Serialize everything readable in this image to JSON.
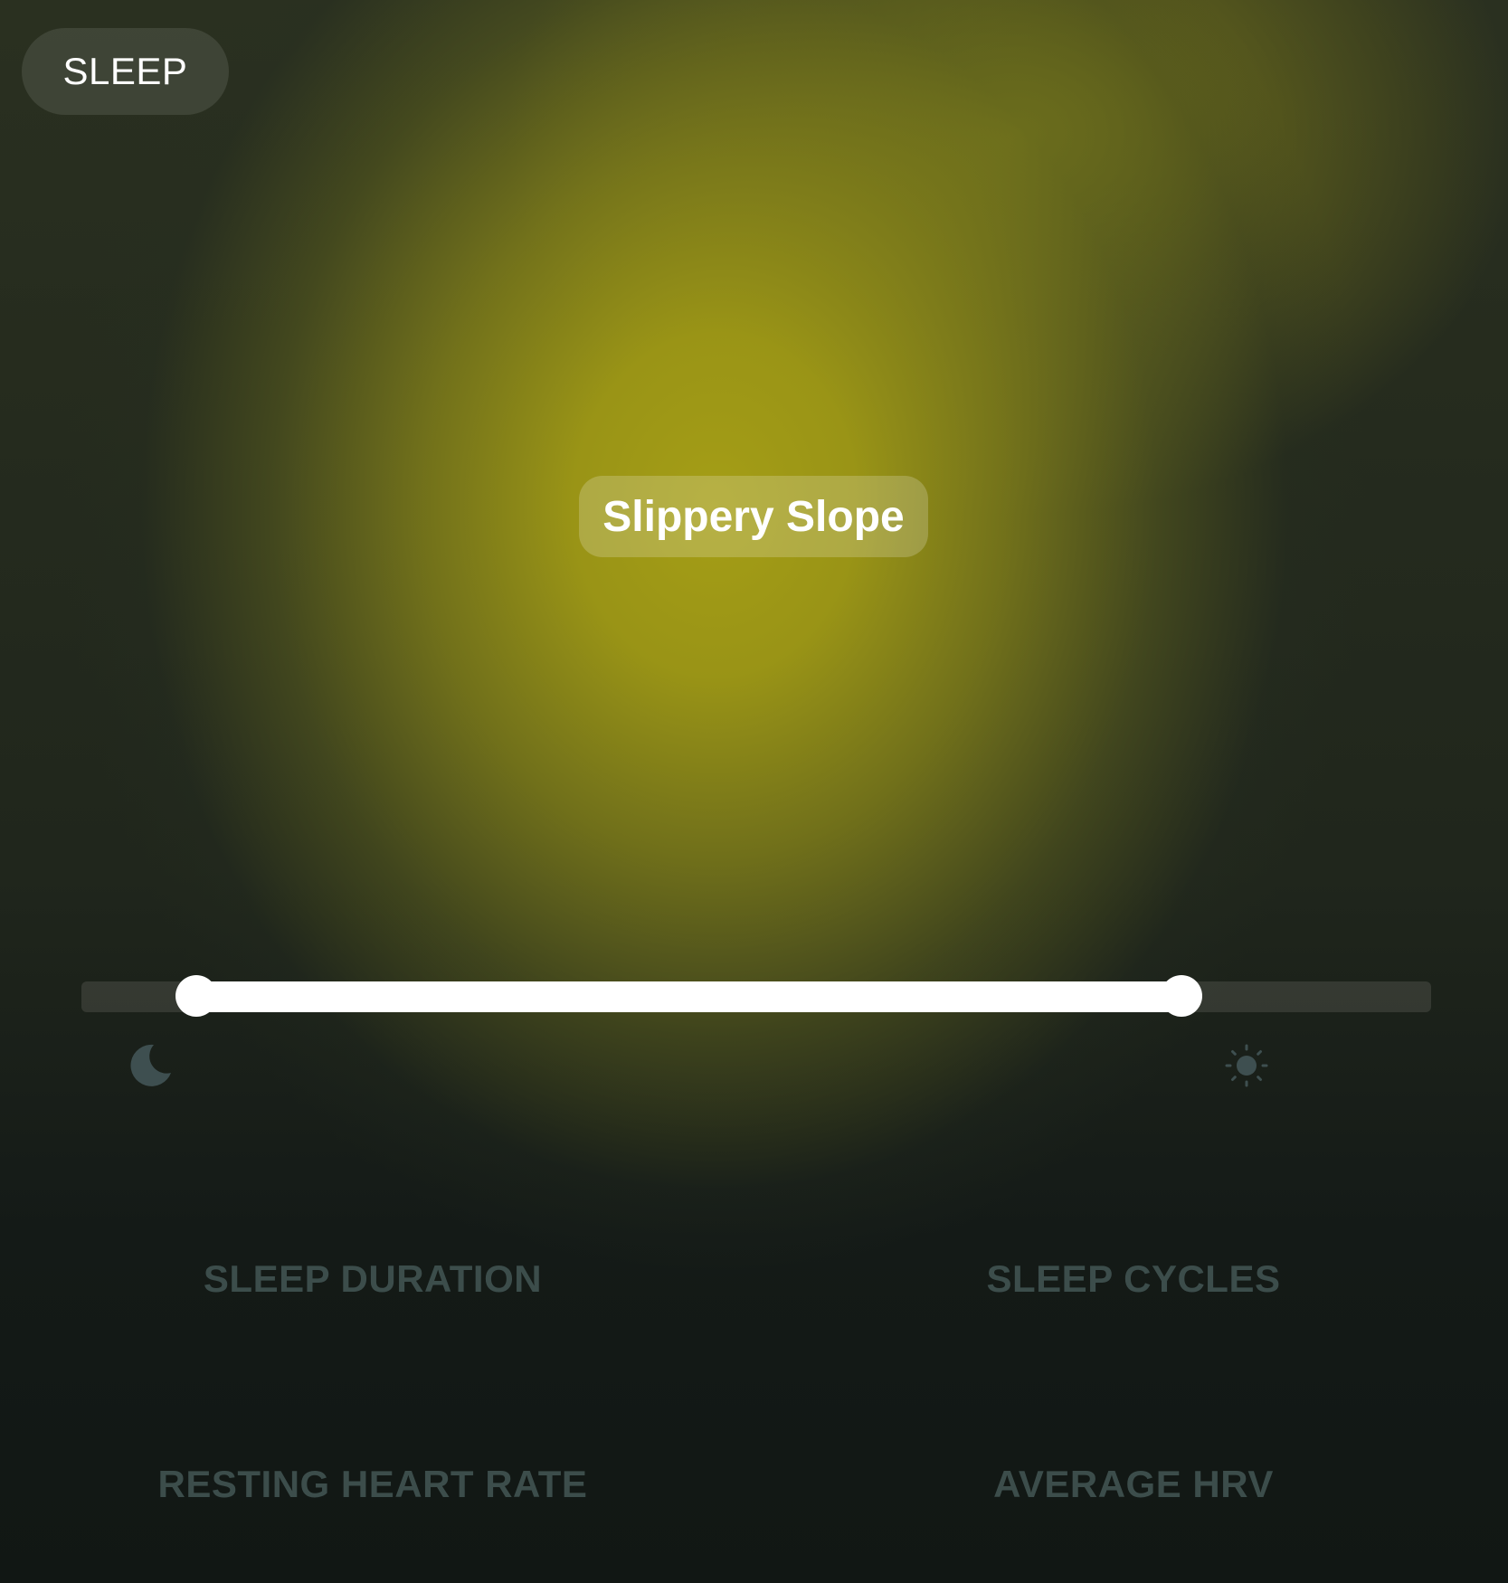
{
  "header": {
    "mode_label": "SLEEP"
  },
  "main": {
    "pattern_label": "Slippery Slope"
  },
  "timeline_slider": {
    "start_fraction": 0.085,
    "end_fraction": 0.815,
    "start_icon": "moon-icon",
    "end_icon": "sun-icon"
  },
  "metrics": [
    {
      "label": "SLEEP DURATION"
    },
    {
      "label": "SLEEP CYCLES"
    },
    {
      "label": "RESTING HEART RATE"
    },
    {
      "label": "AVERAGE HRV"
    }
  ],
  "colors": {
    "glow": "#A59E16",
    "background": "#131915",
    "metric_label": "#3C4D4B",
    "icon": "#3E4F50"
  }
}
